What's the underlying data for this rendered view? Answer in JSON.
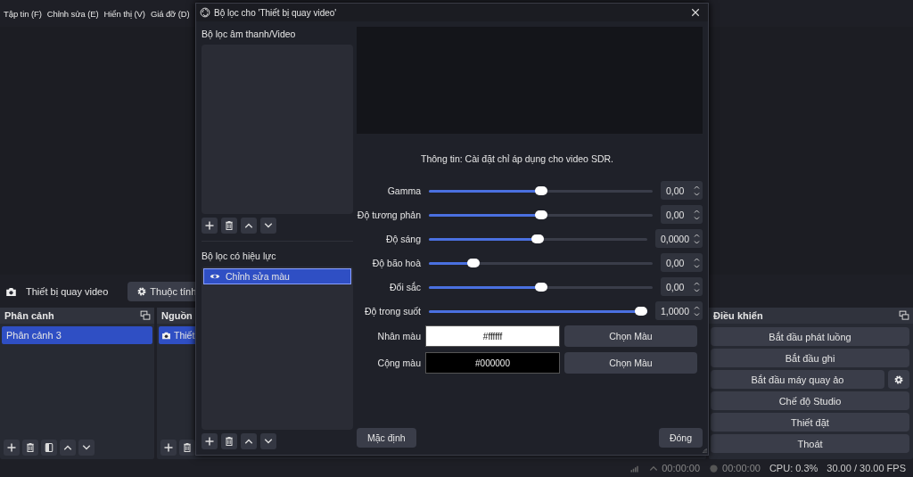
{
  "menu": [
    {
      "label": "Tập tin (F)"
    },
    {
      "label": "Chỉnh sửa (E)"
    },
    {
      "label": "Hiển thị (V)"
    },
    {
      "label": "Giá đỡ (D)"
    }
  ],
  "source_bar": {
    "source": "Thiết bị quay video",
    "button": "Thuộc tính"
  },
  "scenes": {
    "title": "Phân cảnh",
    "items": [
      {
        "label": "Phân cảnh 3",
        "selected": true
      }
    ]
  },
  "sources": {
    "title": "Nguồn",
    "items": [
      {
        "label": "Thiết",
        "selected": true
      }
    ]
  },
  "controls": {
    "title": "Điều khiển",
    "buttons": [
      {
        "label": "Bắt đầu phát luồng",
        "has_settings": false
      },
      {
        "label": "Bắt đầu ghi",
        "has_settings": false
      },
      {
        "label": "Bắt đầu máy quay ảo",
        "has_settings": true
      },
      {
        "label": "Chế độ Studio",
        "has_settings": false
      },
      {
        "label": "Thiết đặt",
        "has_settings": false
      },
      {
        "label": "Thoát",
        "has_settings": false
      }
    ]
  },
  "status_bar": {
    "stream_time": "00:00:00",
    "record_time": "00:00:00",
    "cpu": "CPU: 0.3%",
    "fps": "30.00 / 30.00 FPS"
  },
  "dialog": {
    "title": "Bộ lọc cho 'Thiết bị quay video'",
    "audio_video_label": "Bộ lọc âm thanh/Video",
    "effect_label": "Bộ lọc có hiệu lực",
    "effect_filters": [
      {
        "label": "Chỉnh sửa màu",
        "visible": true,
        "selected": true
      }
    ],
    "info": "Thông tin: Cài đặt chỉ áp dụng cho video SDR.",
    "sliders": [
      {
        "label": "Gamma",
        "level": 0.5,
        "value": "0,00"
      },
      {
        "label": "Độ tương phản",
        "level": 0.5,
        "value": "0,00"
      },
      {
        "label": "Độ sáng",
        "level": 0.5,
        "value": "0,0000"
      },
      {
        "label": "Độ bão hoà",
        "level": 0.18,
        "value": "0,00"
      },
      {
        "label": "Đổi sắc",
        "level": 0.5,
        "value": "0,00"
      },
      {
        "label": "Độ trong suốt",
        "level": 1,
        "value": "1,0000"
      }
    ],
    "colors": [
      {
        "label": "Nhân màu",
        "value": "#ffffff",
        "color": "#ffffff",
        "button": "Chọn Màu"
      },
      {
        "label": "Cộng màu",
        "value": "#000000",
        "color": "#000000",
        "button": "Chọn Màu"
      }
    ],
    "default_button": "Mặc định",
    "close_button": "Đóng"
  }
}
